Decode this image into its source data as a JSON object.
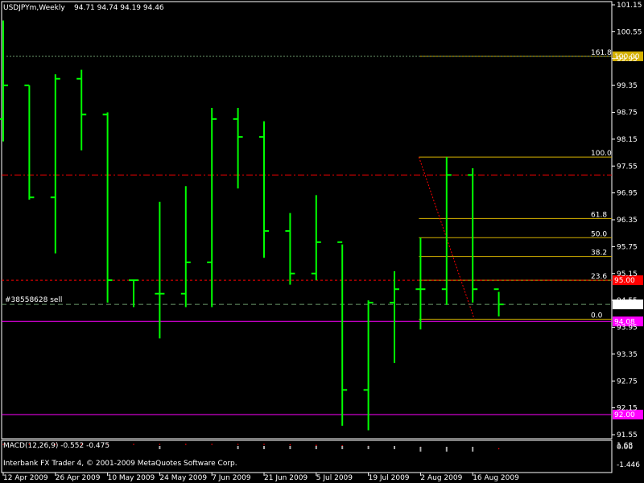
{
  "header": {
    "symbol": "USDJPYm,Weekly",
    "ohlc": "94.71 94.74 94.19 94.46"
  },
  "footer": {
    "credits": "Interbank FX Trader 4, © 2001-2009 MetaQuotes Software Corp."
  },
  "colors": {
    "background": "#000000",
    "bars": "#00ff00",
    "axis": "#ffffff",
    "fibo": "#d4b000",
    "red_dashdot": "#ff0000",
    "red_dashed": "#ff0000",
    "magenta": "#ff00ff",
    "order_line": "#6c9a6c"
  },
  "chart_data": [
    {
      "type": "ohlc",
      "title": "USDJPYm,Weekly",
      "y_ticks": [
        "101.15",
        "100.55",
        "99.95",
        "99.35",
        "98.75",
        "98.15",
        "97.55",
        "96.95",
        "96.35",
        "95.75",
        "95.15",
        "94.55",
        "93.95",
        "93.35",
        "92.75",
        "92.15",
        "91.55"
      ],
      "x_ticks": [
        "12 Apr 2009",
        "26 Apr 2009",
        "10 May 2009",
        "24 May 2009",
        "7 Jun 2009",
        "21 Jun 2009",
        "5 Jul 2009",
        "19 Jul 2009",
        "2 Aug 2009",
        "16 Aug 2009"
      ],
      "bars": [
        {
          "o": 98.6,
          "h": 100.8,
          "l": 98.1,
          "c": 99.35
        },
        {
          "o": 99.35,
          "h": 99.35,
          "l": 96.8,
          "c": 96.85
        },
        {
          "o": 96.85,
          "h": 99.6,
          "l": 95.6,
          "c": 99.5
        },
        {
          "o": 99.5,
          "h": 99.7,
          "l": 97.9,
          "c": 98.7
        },
        {
          "o": 98.7,
          "h": 98.75,
          "l": 94.5,
          "c": 95.0
        },
        {
          "o": 95.0,
          "h": 95.0,
          "l": 94.4,
          "c": 95.0
        },
        {
          "o": 94.7,
          "h": 96.75,
          "l": 93.7,
          "c": 94.7
        },
        {
          "o": 94.7,
          "h": 97.1,
          "l": 94.4,
          "c": 95.4
        },
        {
          "o": 95.4,
          "h": 98.85,
          "l": 94.4,
          "c": 98.6
        },
        {
          "o": 98.6,
          "h": 98.85,
          "l": 97.05,
          "c": 98.2
        },
        {
          "o": 98.2,
          "h": 98.55,
          "l": 95.5,
          "c": 96.1
        },
        {
          "o": 96.1,
          "h": 96.5,
          "l": 94.9,
          "c": 95.15
        },
        {
          "o": 95.15,
          "h": 96.9,
          "l": 95.0,
          "c": 95.85
        },
        {
          "o": 95.85,
          "h": 95.8,
          "l": 91.75,
          "c": 92.55
        },
        {
          "o": 92.55,
          "h": 94.55,
          "l": 91.65,
          "c": 94.5
        },
        {
          "o": 94.5,
          "h": 95.2,
          "l": 93.15,
          "c": 94.8
        },
        {
          "o": 94.8,
          "h": 95.95,
          "l": 93.9,
          "c": 94.8
        },
        {
          "o": 94.8,
          "h": 97.75,
          "l": 94.45,
          "c": 97.35
        },
        {
          "o": 97.35,
          "h": 97.5,
          "l": 94.5,
          "c": 94.8
        },
        {
          "o": 94.8,
          "h": 94.74,
          "l": 94.19,
          "c": 94.46
        }
      ],
      "fibonacci": {
        "levels": [
          {
            "label": "161.8",
            "price": 100.0
          },
          {
            "label": "100.0",
            "price": 97.75
          },
          {
            "label": "61.8",
            "price": 96.38
          },
          {
            "label": "50.0",
            "price": 95.95
          },
          {
            "label": "38.2",
            "price": 95.53
          },
          {
            "label": "23.6",
            "price": 95.0
          },
          {
            "label": "0.0",
            "price": 94.13
          }
        ]
      },
      "horizontal_lines": [
        {
          "price": 97.35,
          "style": "dash-dot",
          "color": "#ff0000"
        },
        {
          "price": 95.0,
          "style": "dashed",
          "color": "#ff0000",
          "tag": "95.00"
        },
        {
          "price": 94.08,
          "style": "solid",
          "color": "#ff00ff",
          "tag": "94.08"
        },
        {
          "price": 92.0,
          "style": "solid",
          "color": "#ff00ff",
          "tag": "92.00"
        },
        {
          "price": 100.0,
          "style": "dotted",
          "color": "#6c9a6c",
          "tag": "100.00"
        }
      ],
      "order": {
        "label": "#38558628 sell",
        "price": 94.46
      },
      "current_price": {
        "label": "94.46",
        "price": 94.46
      }
    },
    {
      "type": "bar",
      "title": "MACD(12,26,9) -0.552 -0.475",
      "y_ticks": [
        "1.68",
        "0.00",
        "-1.446"
      ]
    }
  ]
}
